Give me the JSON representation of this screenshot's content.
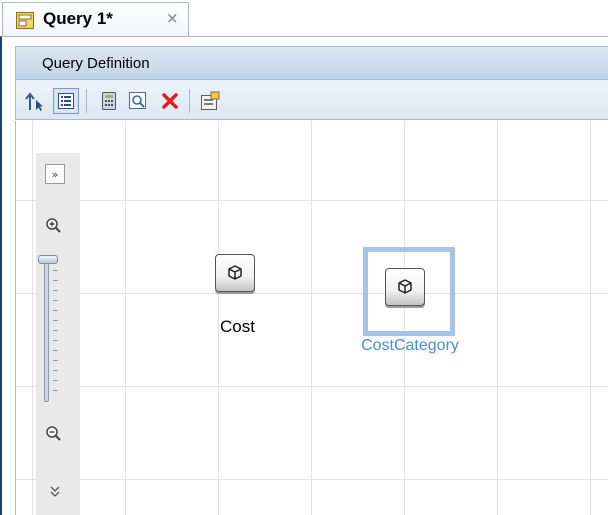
{
  "tab": {
    "title": "Query 1*",
    "close_glyph": "×",
    "icon": "query-icon"
  },
  "section": {
    "title": "Query Definition"
  },
  "toolbar": {
    "buttons": [
      {
        "name": "navigate-up",
        "icon": "arrow-up-cursor-icon",
        "active": false
      },
      {
        "name": "list-view",
        "icon": "list-icon",
        "active": true
      },
      {
        "name": "calculator",
        "icon": "calculator-icon",
        "active": false
      },
      {
        "name": "preview",
        "icon": "magnifier-icon",
        "active": false
      },
      {
        "name": "delete",
        "icon": "red-x-icon",
        "active": false
      },
      {
        "name": "properties",
        "icon": "properties-icon",
        "active": false
      }
    ]
  },
  "zoom": {
    "expand_glyph": "»",
    "collapse_glyph": "»",
    "level": 1.0
  },
  "nodes": [
    {
      "label": "Cost",
      "selected": false,
      "icon": "cube-icon"
    },
    {
      "label": "CostCategory",
      "selected": true,
      "icon": "cube-icon"
    }
  ],
  "colors": {
    "selection": "#a9c3e8",
    "selected_label": "#4a8ad8",
    "header": "#c3d3e8",
    "delete": "#e02020"
  }
}
